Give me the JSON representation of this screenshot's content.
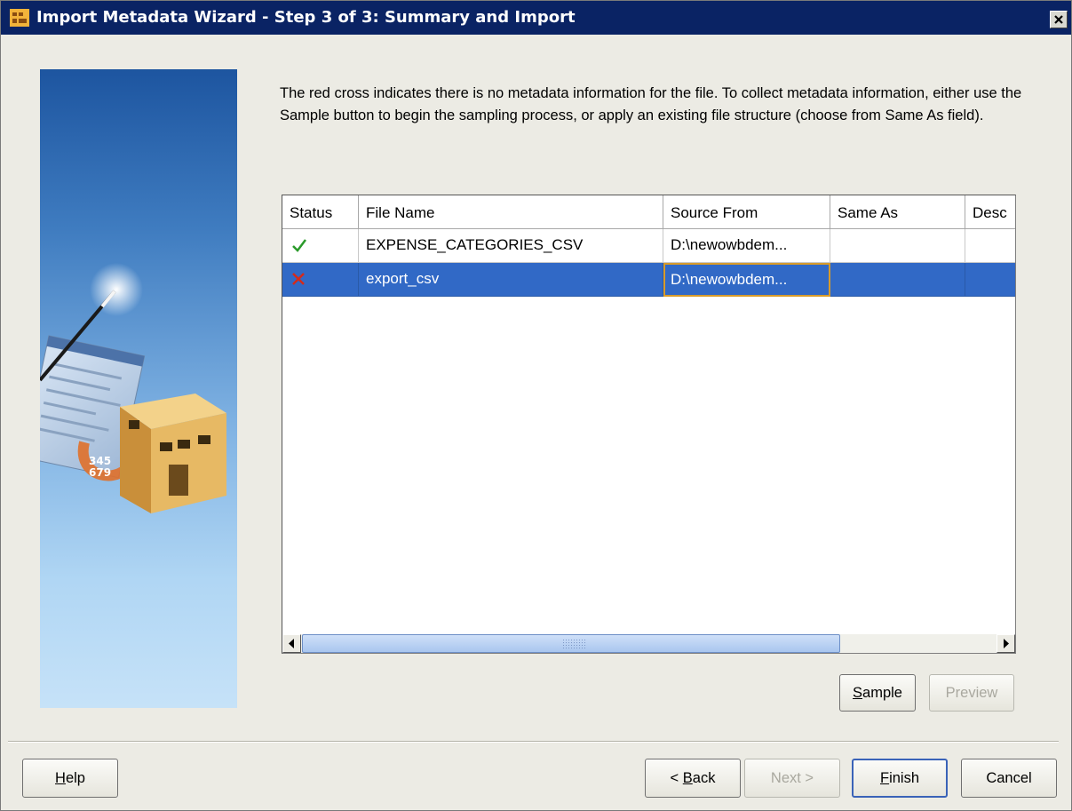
{
  "window": {
    "title": "Import Metadata Wizard - Step 3 of 3: Summary and Import"
  },
  "instruction": "The red cross indicates there is no metadata information for the file. To collect metadata information, either use the Sample button to begin the sampling process, or apply an existing file structure (choose from Same As field).",
  "table": {
    "columns": [
      "Status",
      "File Name",
      "Source From",
      "Same As",
      "Desc"
    ],
    "rows": [
      {
        "status": "check-icon",
        "status_color": "#2a9a2a",
        "file_name": "EXPENSE_CATEGORIES_CSV",
        "source_from": "D:\\newowbdem...",
        "same_as": "",
        "desc": "",
        "selected": false
      },
      {
        "status": "red-cross-icon",
        "status_color": "#d42a1a",
        "file_name": "export_csv",
        "source_from": "D:\\newowbdem...",
        "same_as": "",
        "desc": "",
        "selected": true
      }
    ]
  },
  "buttons": {
    "sample_first": "S",
    "sample_rest": "ample",
    "preview": "Preview",
    "help_first": "H",
    "help_rest": "elp",
    "back_prefix": "< ",
    "back_first": "B",
    "back_rest": "ack",
    "next": "Next >",
    "finish_first": "F",
    "finish_rest": "inish",
    "cancel": "Cancel"
  },
  "colors": {
    "title_bar": "#0a2364",
    "selection": "#3169c6",
    "focus_border": "#d89b2a"
  }
}
